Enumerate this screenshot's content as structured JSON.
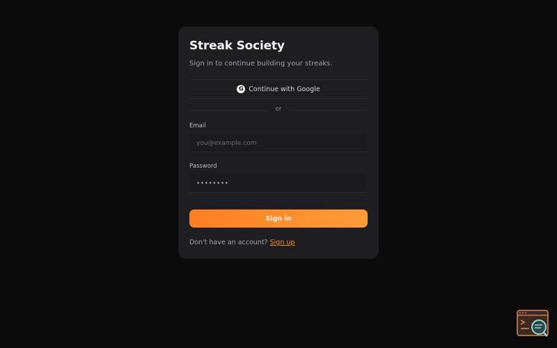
{
  "card": {
    "title": "Streak Society",
    "subtitle": "Sign in to continue building your streaks."
  },
  "google": {
    "icon": "google-icon",
    "icon_glyph": "G",
    "label": "Continue with Google"
  },
  "divider": {
    "text": "or"
  },
  "email": {
    "label": "Email",
    "placeholder": "you@example.com",
    "value": ""
  },
  "password": {
    "label": "Password",
    "value": "••••••••"
  },
  "signin": {
    "label": "Sign in"
  },
  "signup": {
    "prompt": "Don't have an account?",
    "link": "Sign up"
  },
  "colors": {
    "background": "#0b0b0b",
    "card": "#1e1e20",
    "accent": "#ff7f1f",
    "accent_end": "#ff9b3a",
    "link": "#ff8a2a"
  },
  "corner_widget": {
    "icon": "terminal-search-icon"
  }
}
